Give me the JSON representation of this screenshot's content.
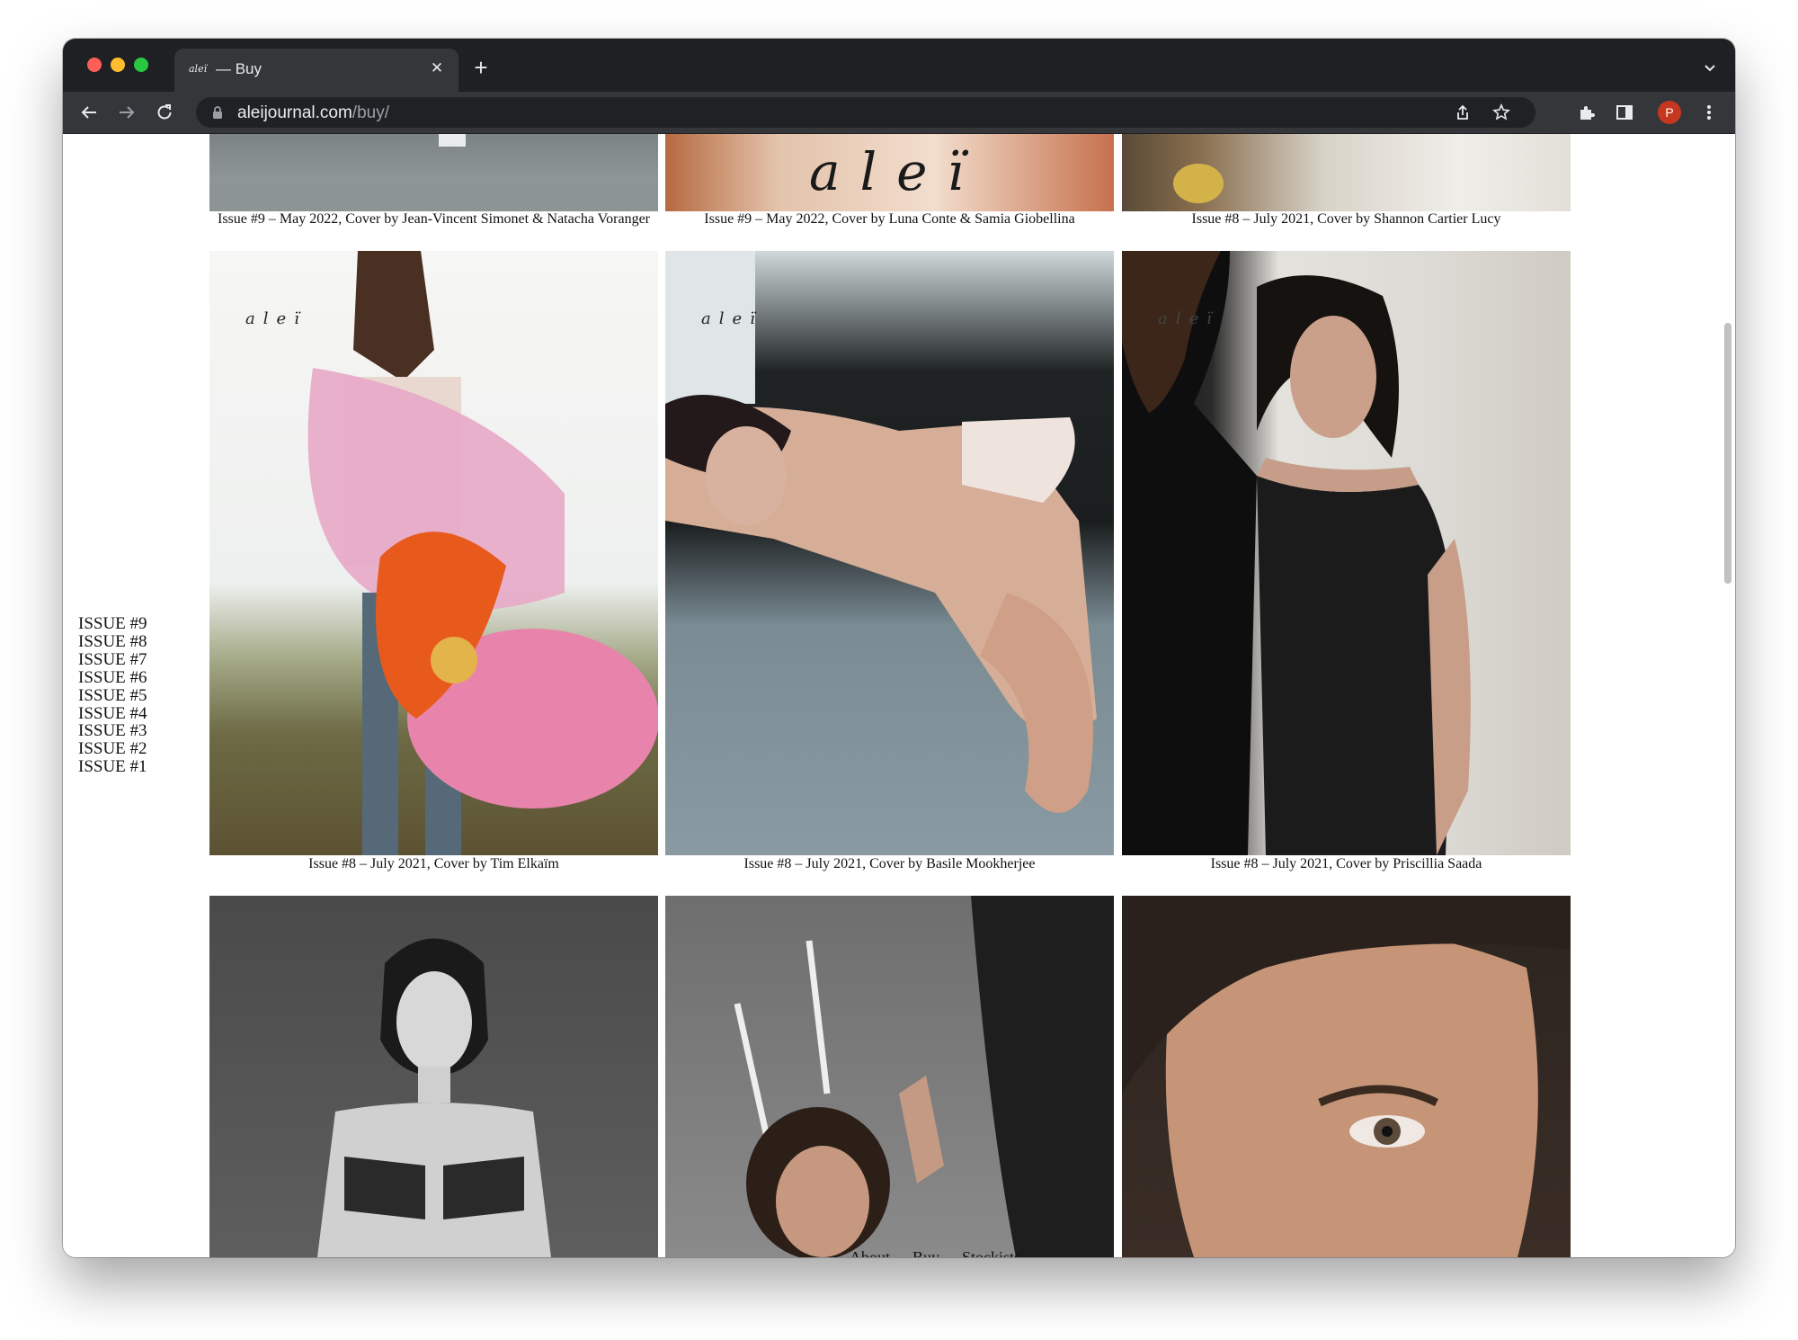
{
  "browser": {
    "tab_title": "— Buy",
    "tab_favicon_text": "aleï",
    "url_host": "aleijournal.com",
    "url_path": "/buy/",
    "profile_initial": "P"
  },
  "sidebar": {
    "issues": [
      "ISSUE #9",
      "ISSUE #8",
      "ISSUE #7",
      "ISSUE #6",
      "ISSUE #5",
      "ISSUE #4",
      "ISSUE #3",
      "ISSUE #2",
      "ISSUE #1"
    ]
  },
  "covers": {
    "row1": [
      {
        "caption": "Issue #9 – May 2022, Cover by Jean-Vincent Simonet & Natacha Voranger"
      },
      {
        "caption": "Issue #9 – May 2022, Cover by Luna Conte & Samia Giobellina",
        "masthead": "aleï"
      },
      {
        "caption": "Issue #8 – July 2021, Cover by Shannon Cartier Lucy"
      }
    ],
    "row2": [
      {
        "caption": "Issue #8 – July 2021, Cover by Tim Elkaïm",
        "masthead": "aleï"
      },
      {
        "caption": "Issue #8 – July 2021, Cover by Basile Mookherjee",
        "masthead": "aleï"
      },
      {
        "caption": "Issue #8 – July 2021, Cover by Priscillia Saada",
        "masthead": "aleï"
      }
    ]
  },
  "footer": {
    "about": "About",
    "sep": "–",
    "buy": "Buy",
    "stockists": "Stockists"
  }
}
